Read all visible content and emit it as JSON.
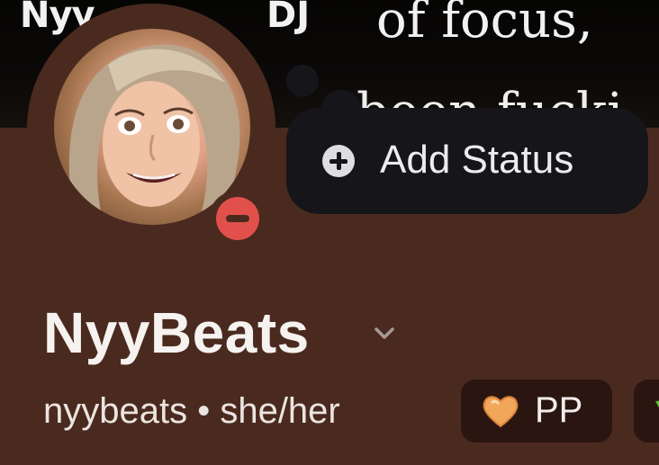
{
  "banner": {
    "text_fragment_1": "Nyy",
    "text_fragment_2": "DJ",
    "text_fragment_3": "of focus, ",
    "text_fragment_4": "been fucki"
  },
  "status": {
    "add_label": "Add Status",
    "presence": "do-not-disturb",
    "presence_color": "#e2504b"
  },
  "profile": {
    "display_name": "NyyBeats",
    "username": "nyybeats",
    "separator": "•",
    "pronouns": "she/her",
    "meta_line": "nyybeats • she/her"
  },
  "tags": [
    {
      "icon": "heart-icon",
      "label": "PP",
      "color": "#f2a65a"
    },
    {
      "icon": "leaf-icon",
      "label": "",
      "color": "#5fbf3c"
    }
  ],
  "colors": {
    "panel": "#4a2a1f",
    "status_bubble": "#16161a",
    "tag_pill": "#2a1510"
  }
}
